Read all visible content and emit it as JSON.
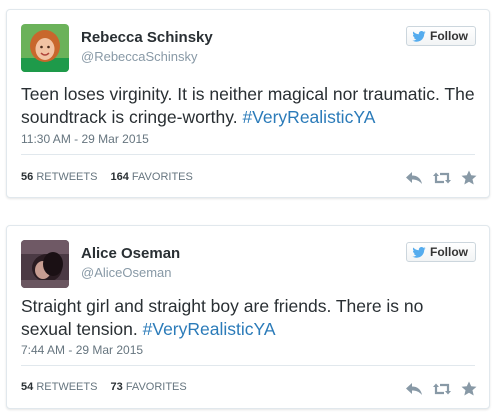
{
  "tweets": [
    {
      "name": "Rebecca Schinsky",
      "handle": "@RebeccaSchinsky",
      "follow_label": "Follow",
      "text": "Teen loses virginity. It is neither magical nor traumatic. The soundtrack is cringe-worthy.",
      "hashtag": "#VeryRealisticYA",
      "time": "11:30 AM - 29 Mar 2015",
      "retweets": "56",
      "retweets_label": "RETWEETS",
      "favorites": "164",
      "favorites_label": "FAVORITES"
    },
    {
      "name": "Alice Oseman",
      "handle": "@AliceOseman",
      "follow_label": "Follow",
      "text": "Straight girl and straight boy are friends. There is no sexual tension.",
      "hashtag": "#VeryRealisticYA",
      "time": "7:44 AM - 29 Mar 2015",
      "retweets": "54",
      "retweets_label": "RETWEETS",
      "favorites": "73",
      "favorites_label": "FAVORITES"
    }
  ],
  "colors": {
    "accent": "#2b7bb9",
    "bird": "#55acee",
    "name": "#292f33",
    "meta": "#8899a6",
    "icon": "#8899a6"
  },
  "icons": [
    "twitter-bird-icon",
    "reply-icon",
    "retweet-icon",
    "favorite-star-icon"
  ]
}
